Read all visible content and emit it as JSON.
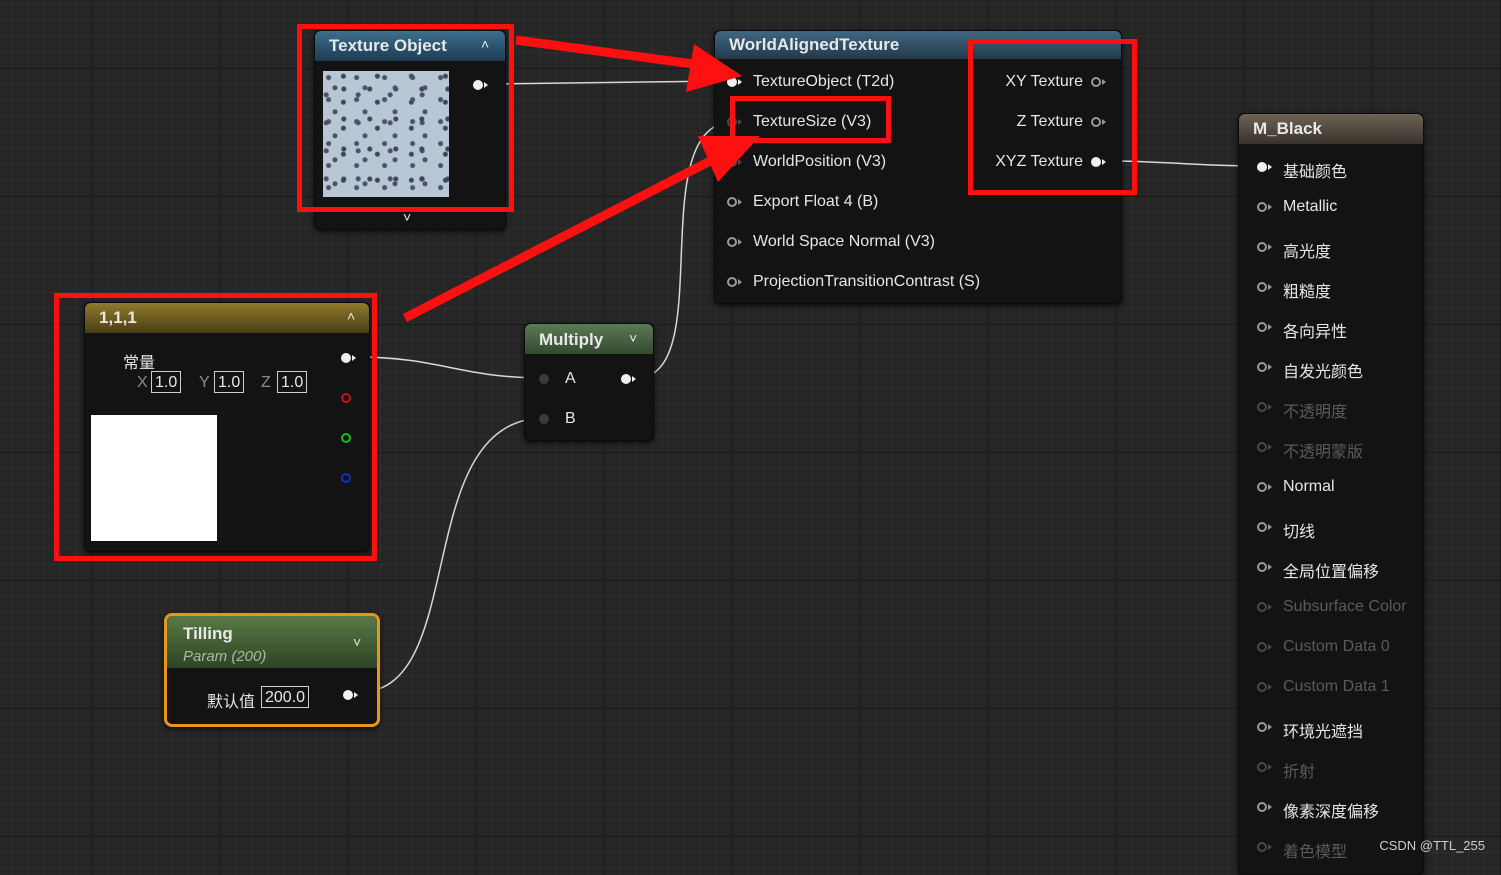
{
  "texture_object": {
    "title": "Texture Object"
  },
  "world_aligned": {
    "title": "WorldAlignedTexture",
    "inputs": [
      "TextureObject (T2d)",
      "TextureSize (V3)",
      "WorldPosition (V3)",
      "Export Float 4 (B)",
      "World Space Normal (V3)",
      "ProjectionTransitionContrast (S)"
    ],
    "outputs": [
      "XY Texture",
      "Z Texture",
      "XYZ Texture"
    ]
  },
  "constant": {
    "title": "1,1,1",
    "label": "常量",
    "x_label": "X",
    "y_label": "Y",
    "z_label": "Z",
    "x": "1.0",
    "y": "1.0",
    "z": "1.0"
  },
  "multiply": {
    "title": "Multiply",
    "a": "A",
    "b": "B"
  },
  "tilling": {
    "title": "Tilling",
    "subtitle": "Param (200)",
    "default_label": "默认值",
    "default_value": "200.0"
  },
  "material": {
    "title": "M_Black",
    "inputs": [
      {
        "label": "基础颜色",
        "state": "on"
      },
      {
        "label": "Metallic",
        "state": "off"
      },
      {
        "label": "高光度",
        "state": "off"
      },
      {
        "label": "粗糙度",
        "state": "off"
      },
      {
        "label": "各向异性",
        "state": "off"
      },
      {
        "label": "自发光颜色",
        "state": "off"
      },
      {
        "label": "不透明度",
        "state": "dim"
      },
      {
        "label": "不透明蒙版",
        "state": "dim"
      },
      {
        "label": "Normal",
        "state": "off"
      },
      {
        "label": "切线",
        "state": "off"
      },
      {
        "label": "全局位置偏移",
        "state": "off"
      },
      {
        "label": "Subsurface Color",
        "state": "dim"
      },
      {
        "label": "Custom Data 0",
        "state": "dim"
      },
      {
        "label": "Custom Data 1",
        "state": "dim"
      },
      {
        "label": "环境光遮挡",
        "state": "off"
      },
      {
        "label": "折射",
        "state": "dim"
      },
      {
        "label": "像素深度偏移",
        "state": "off"
      },
      {
        "label": "着色模型",
        "state": "dim"
      }
    ]
  },
  "watermark": "CSDN @TTL_255",
  "colors": {
    "annotation": "#ff1010",
    "tilling_border": "#e8961a"
  }
}
